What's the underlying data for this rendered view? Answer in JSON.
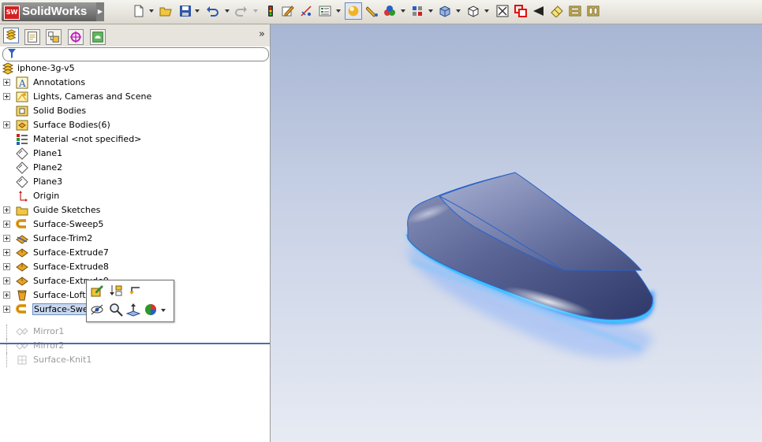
{
  "app": {
    "logo_text": "SolidWorks",
    "logo_badge": "SW"
  },
  "toolbar": {
    "icons": [
      "new-document-icon",
      "open-folder-icon",
      "save-icon",
      "undo-icon",
      "redo-icon",
      "rebuild-icon",
      "sketch-icon",
      "smart-dimension-icon",
      "options-icon",
      "appearance-icon",
      "edit-appearance-icon",
      "scene-icon",
      "view-orientation-icon",
      "display-style-icon",
      "hide-show-icon",
      "zoom-to-fit-icon",
      "zoom-to-area-icon",
      "previous-view-icon",
      "section-view-icon",
      "view-settings-icon",
      "tile-icon"
    ]
  },
  "tree": {
    "root": "iphone-3g-v5",
    "items": [
      {
        "label": "Annotations",
        "icon": "annotations-icon",
        "expander": true
      },
      {
        "label": "Lights, Cameras and Scene",
        "icon": "lights-icon",
        "expander": true
      },
      {
        "label": "Solid Bodies",
        "icon": "solid-bodies-icon",
        "expander": false
      },
      {
        "label": "Surface Bodies(6)",
        "icon": "surface-bodies-icon",
        "expander": true
      },
      {
        "label": "Material <not specified>",
        "icon": "material-icon",
        "expander": false
      },
      {
        "label": "Plane1",
        "icon": "plane-icon",
        "expander": false
      },
      {
        "label": "Plane2",
        "icon": "plane-icon",
        "expander": false
      },
      {
        "label": "Plane3",
        "icon": "plane-icon",
        "expander": false
      },
      {
        "label": "Origin",
        "icon": "origin-icon",
        "expander": false
      },
      {
        "label": "Guide Sketches",
        "icon": "folder-icon",
        "expander": true
      },
      {
        "label": "Surface-Sweep5",
        "icon": "sweep-icon",
        "expander": true
      },
      {
        "label": "Surface-Trim2",
        "icon": "trim-icon",
        "expander": true
      },
      {
        "label": "Surface-Extrude7",
        "icon": "extrude-icon",
        "expander": true
      },
      {
        "label": "Surface-Extrude8",
        "icon": "extrude-icon",
        "expander": true
      },
      {
        "label": "Surface-Extrude9",
        "icon": "extrude-icon",
        "expander": true
      },
      {
        "label": "Surface-Loft1",
        "icon": "loft-icon",
        "expander": true
      },
      {
        "label": "Surface-Sweep6",
        "icon": "sweep-icon",
        "expander": true,
        "selected": true
      }
    ],
    "suppressed": [
      {
        "label": "Mirror1",
        "icon": "mirror-icon"
      },
      {
        "label": "Mirror2",
        "icon": "mirror-icon"
      },
      {
        "label": "Surface-Knit1",
        "icon": "knit-icon"
      }
    ]
  },
  "context_toolbar": {
    "icons": [
      "edit-feature-icon",
      "rollback-icon",
      "parent-child-icon",
      "hide-icon",
      "zoom-to-selection-icon",
      "normal-to-icon",
      "appearance-icon"
    ]
  },
  "colors": {
    "accent": "#4a6ea8",
    "selection": "#c8d8ef",
    "model_edge": "#2ea8ff"
  }
}
